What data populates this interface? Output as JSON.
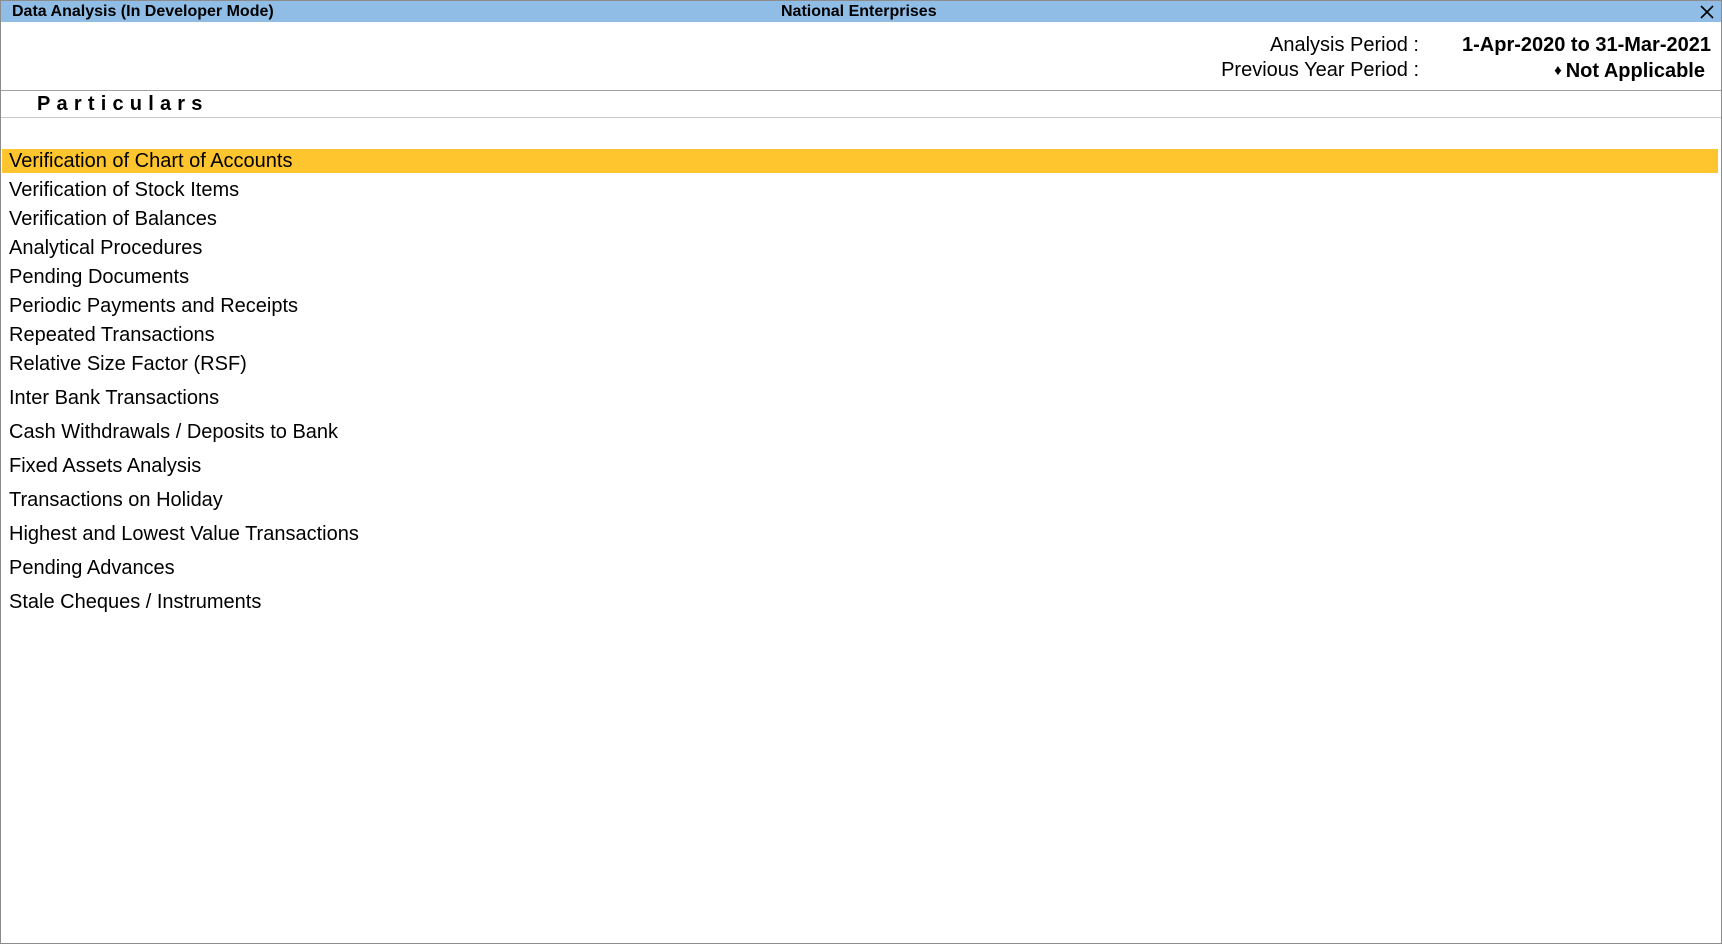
{
  "window": {
    "title": "Data Analysis (In Developer Mode)",
    "company": "National Enterprises"
  },
  "period": {
    "analysis_label": "Analysis Period :",
    "analysis_value": "1-Apr-2020 to 31-Mar-2021",
    "previous_label": "Previous Year Period :",
    "previous_marker": "♦",
    "previous_value": "Not Applicable"
  },
  "columns": {
    "particulars": "Particulars"
  },
  "menu": {
    "selected_index": 0,
    "items": [
      "Verification of Chart of Accounts",
      "Verification of Stock Items",
      "Verification of Balances",
      "Analytical Procedures",
      "Pending Documents",
      "Periodic Payments and Receipts",
      "Repeated Transactions",
      "Relative Size Factor (RSF)",
      "Inter Bank Transactions",
      "Cash Withdrawals / Deposits to Bank",
      "Fixed Assets Analysis",
      "Transactions on Holiday",
      "Highest and Lowest Value Transactions",
      "Pending Advances",
      "Stale Cheques / Instruments"
    ]
  },
  "colors": {
    "titlebar": "#8fbde6",
    "selection": "#fec52e"
  }
}
